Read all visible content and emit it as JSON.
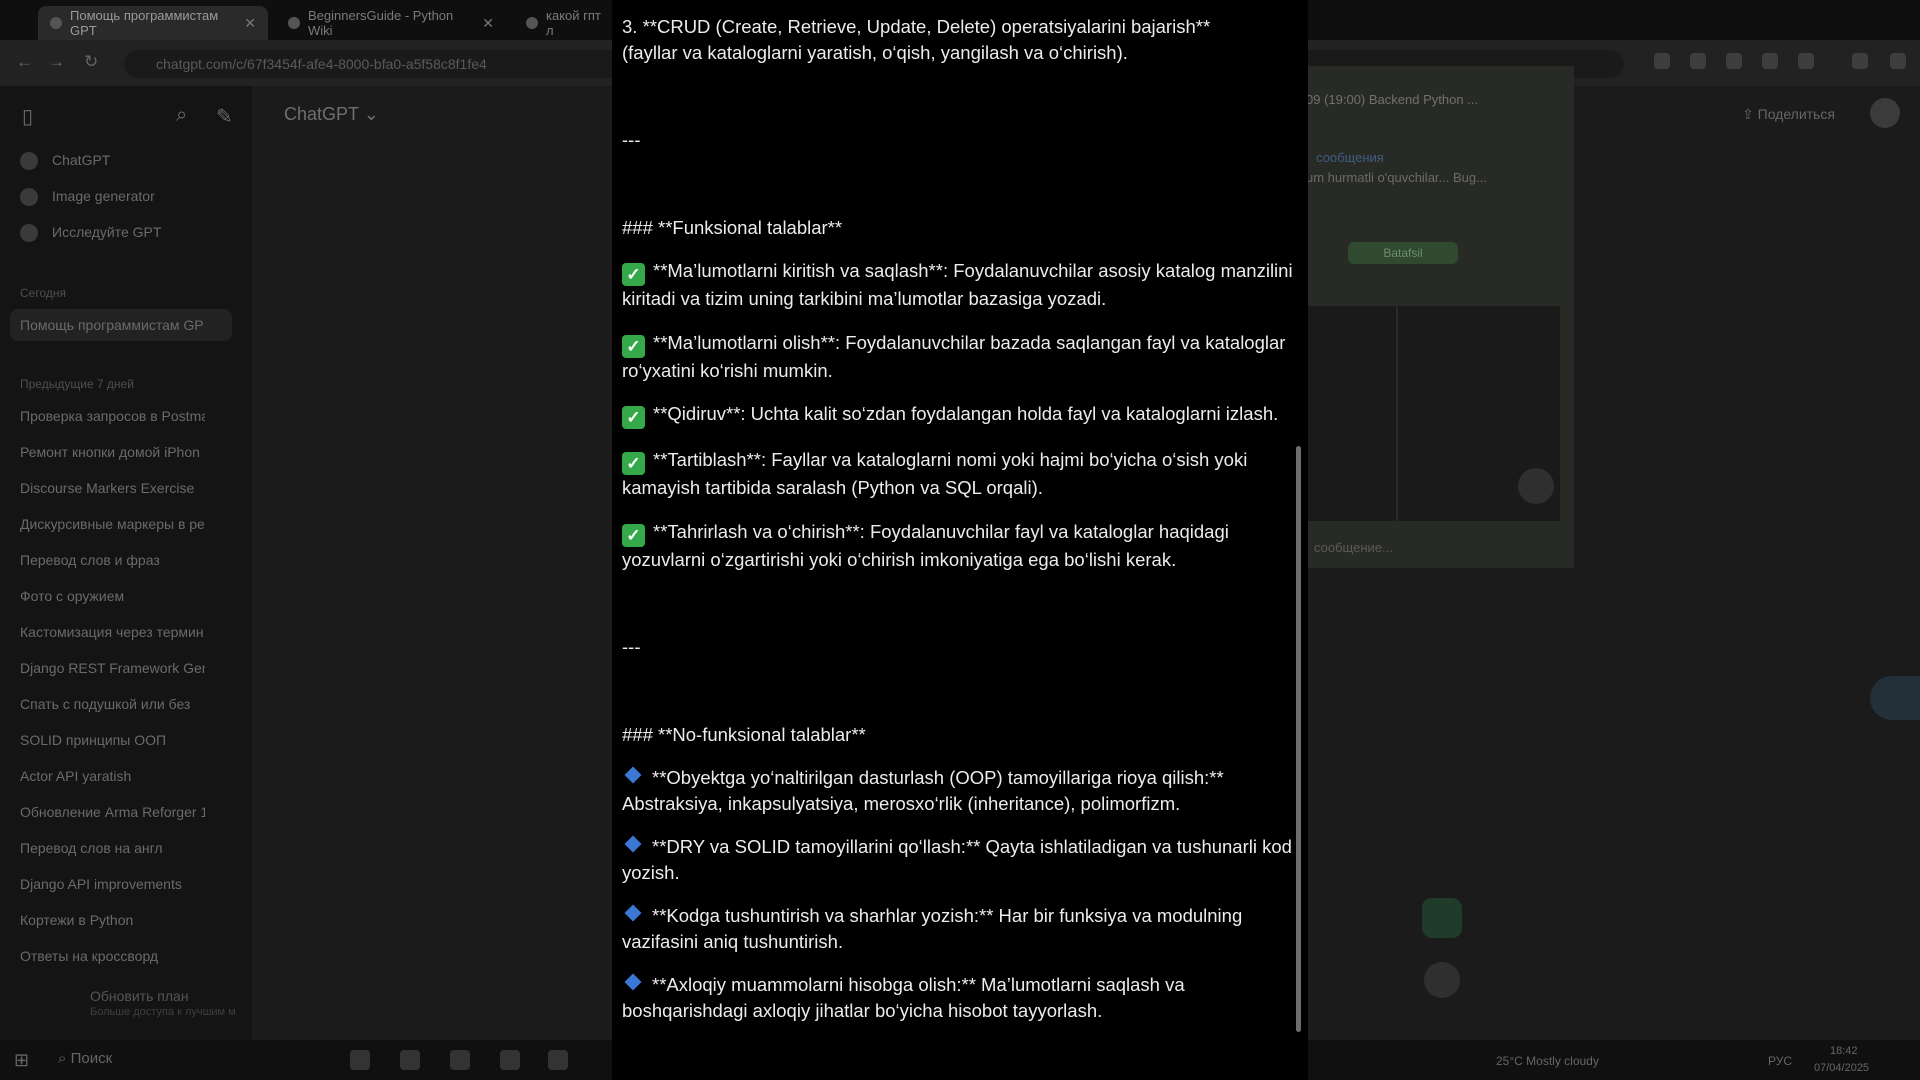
{
  "browser": {
    "tabs": [
      {
        "label": "Помощь программистам GPT",
        "active": true
      },
      {
        "label": "BeginnersGuide - Python Wiki",
        "active": false
      },
      {
        "label": "какой гпт л",
        "active": false
      }
    ],
    "url": "chatgpt.com/c/67f3454f-afe4-8000-bfa0-a5f58c8f1fe4"
  },
  "sidebar": {
    "top_items": [
      {
        "label": "ChatGPT",
        "icon": "chatgpt-icon"
      },
      {
        "label": "Image generator",
        "icon": "image-generator-icon"
      },
      {
        "label": "Исследуйте GPT",
        "icon": "grid-icon"
      }
    ],
    "sections": [
      {
        "title": "Сегодня",
        "items": [
          "Помощь программистам GP"
        ]
      },
      {
        "title": "Предыдущие 7 дней",
        "items": [
          "Проверка запросов в Postma",
          "Ремонт кнопки домой iPhon",
          "Discourse Markers Exercise",
          "Дискурсивные маркеры в ре",
          "Перевод слов и фраз",
          "Фото с оружием",
          "Кастомизация через термин",
          "Django REST Framework Gene",
          "Спать с подушкой или без",
          "SOLID принципы ООП",
          "Actor API yaratish",
          "Обновление Arma Reforger 1",
          "Перевод слов на англ",
          "Django API improvements",
          "Кортежи в Python",
          "Ответы на кроссворд"
        ]
      }
    ],
    "upgrade": {
      "title": "Обновить план",
      "subtitle": "Больше доступа к лучшим м"
    }
  },
  "main": {
    "model_title": "ChatGPT",
    "share_label": "Поделиться"
  },
  "telegram": {
    "chat_title": "09 (19:00) Backend Python ...",
    "message_preview": "сообщения",
    "message_text": "um hurmatli o'quvchilar... Bug...",
    "button": "Batafsil",
    "input_placeholder": "сообщение..."
  },
  "taskbar": {
    "search_label": "Поиск",
    "weather": "25°C  Mostly cloudy",
    "lang": "РУС",
    "time": "18:42",
    "date": "07/04/2025"
  },
  "viewer": {
    "crud_line1": "3. **CRUD (Create, Retrieve, Update, Delete) operatsiyalarini bajarish**",
    "crud_line2": "(fayllar va kataloglarni yaratish, o‘qish, yangilash va o‘chirish).",
    "separator1": "---",
    "func_heading": "### **Funksional talablar**",
    "functional": [
      "**Ma’lumotlarni kiritish va saqlash**: Foydalanuvchilar asosiy katalog manzilini kiritadi va tizim uning tarkibini ma’lumotlar bazasiga yozadi.",
      "**Ma’lumotlarni olish**: Foydalanuvchilar bazada saqlangan fayl va kataloglar ro‘yxatini ko‘rishi mumkin.",
      "**Qidiruv**: Uchta kalit so‘zdan foydalangan holda fayl va kataloglarni izlash.",
      "**Tartiblash**: Fayllar va kataloglarni nomi yoki hajmi bo‘yicha o‘sish yoki kamayish tartibida saralash (Python va SQL orqali).",
      "**Tahrirlash va o‘chirish**: Foydalanuvchilar fayl va kataloglar haqidagi yozuvlarni o‘zgartirishi yoki o‘chirish imkoniyatiga ega bo‘lishi kerak."
    ],
    "separator2": "---",
    "nonfunc_heading": "### **No-funksional talablar**",
    "nonfunctional": [
      "**Obyektga yo‘naltirilgan dasturlash (OOP) tamoyillariga rioya qilish:** Abstraksiya, inkapsulyatsiya, merosxo‘rlik (inheritance), polimorfizm.",
      "**DRY va SOLID tamoyillarini qo‘llash:** Qayta ishlatiladigan va tushunarli kod yozish.",
      "**Kodga tushuntirish va sharhlar yozish:** Har bir funksiya va modulning vazifasini aniq tushuntirish.",
      "**Axloqiy muammolarni hisobga olish:** Ma’lumotlarni saqlash va boshqarishdagi axloqiy jihatlar bo‘yicha hisobot tayyorlash."
    ]
  }
}
